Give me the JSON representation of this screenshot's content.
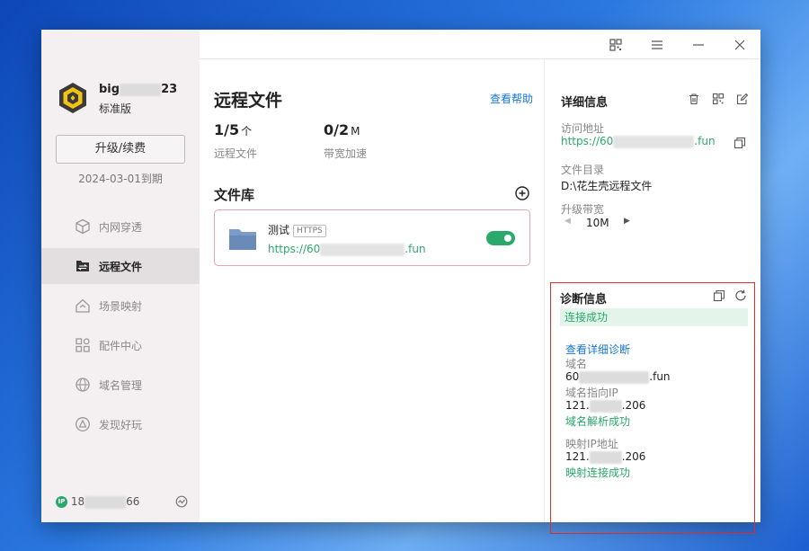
{
  "colors": {
    "accent_green": "#2aa96a",
    "link_blue": "#1677d2",
    "alert_red": "#d9302f"
  },
  "sidebar": {
    "username_start": "big",
    "username_end": "23",
    "edition": "标准版",
    "upgrade_label": "升级/续费",
    "expiry": "2024-03-01到期",
    "items": [
      {
        "label": "内网穿透",
        "icon": "cube-icon"
      },
      {
        "label": "远程文件",
        "icon": "file-transfer-icon"
      },
      {
        "label": "场景映射",
        "icon": "house-icon"
      },
      {
        "label": "配件中心",
        "icon": "grid-icon"
      },
      {
        "label": "域名管理",
        "icon": "globe-icon"
      },
      {
        "label": "发现好玩",
        "icon": "triangle-icon"
      }
    ],
    "ip_badge": "IP",
    "ip_start": "18",
    "ip_end": "66"
  },
  "main": {
    "title": "远程文件",
    "help_link": "查看帮助",
    "stats": [
      {
        "value": "1/5",
        "unit": "个",
        "label": "远程文件"
      },
      {
        "value": "0/2",
        "unit": "M",
        "label": "带宽加速"
      }
    ],
    "library_title": "文件库",
    "card": {
      "name": "测试",
      "badge": "HTTPS",
      "url_start": "https://60",
      "url_end": ".fun",
      "enabled": true
    }
  },
  "details": {
    "title": "详细信息",
    "access_label": "访问地址",
    "access_start": "https://60",
    "access_end": ".fun",
    "dir_label": "文件目录",
    "dir_value": "D:\\花生壳远程文件",
    "bandwidth_label": "升级带宽",
    "bandwidth_value": "10M"
  },
  "diagnosis": {
    "title": "诊断信息",
    "status": "连接成功",
    "detail_link": "查看详细诊断",
    "domain_label": "域名",
    "domain_start": "60",
    "domain_end": ".fun",
    "domain_ip_label": "域名指向IP",
    "domain_ip_start": "121.",
    "domain_ip_end": ".206",
    "domain_result": "域名解析成功",
    "map_ip_label": "映射IP地址",
    "map_ip_start": "121.",
    "map_ip_end": ".206",
    "map_result": "映射连接成功"
  }
}
